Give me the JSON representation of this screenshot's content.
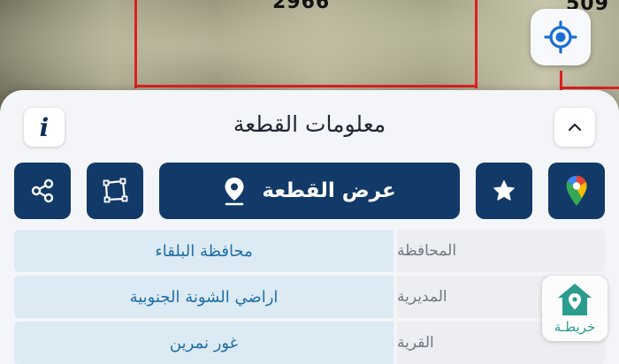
{
  "map": {
    "parcel_number_main": "2966",
    "parcel_number_edge": "509",
    "locate_icon": "crosshair-target-icon",
    "line_color": "#e0201e"
  },
  "sheet": {
    "title": "معلومات القطعة",
    "info_icon": "info-icon",
    "collapse_icon": "chevron-up-icon"
  },
  "actions": {
    "share_icon": "share-icon",
    "area_icon": "polygon-outline-icon",
    "main_label": "عرض القطعة",
    "main_icon": "location-pin-icon",
    "favorite_icon": "star-icon",
    "maps_icon": "google-maps-icon",
    "color": "#123a68"
  },
  "details": [
    {
      "key": "المحافظة",
      "value": "محافظة البلقاء"
    },
    {
      "key": "المديرية",
      "value": "اراضي الشونة الجنوبية"
    },
    {
      "key": "القرية",
      "value": "غور نمرين"
    }
  ],
  "badge": {
    "label": "خريطـة",
    "icon": "house-pin-icon"
  }
}
